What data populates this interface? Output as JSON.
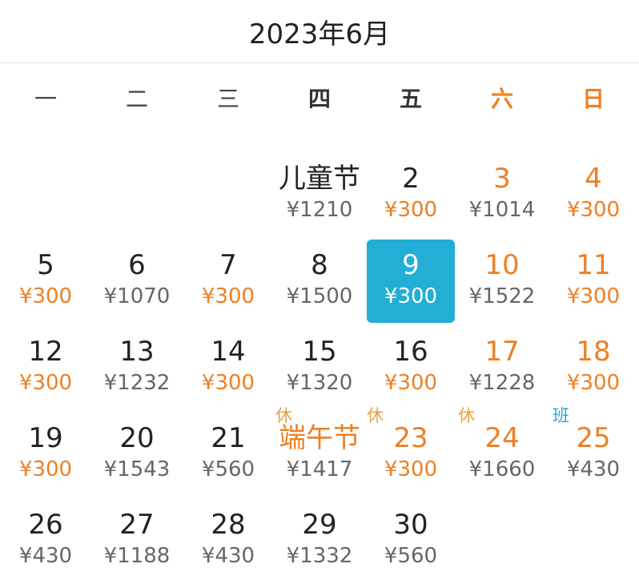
{
  "header": {
    "title": "2023年6月"
  },
  "weekdays": [
    {
      "label": "一",
      "weekend": false,
      "bold": false
    },
    {
      "label": "二",
      "weekend": false,
      "bold": false
    },
    {
      "label": "三",
      "weekend": false,
      "bold": false
    },
    {
      "label": "四",
      "weekend": false,
      "bold": true
    },
    {
      "label": "五",
      "weekend": false,
      "bold": true
    },
    {
      "label": "六",
      "weekend": true,
      "bold": true
    },
    {
      "label": "日",
      "weekend": true,
      "bold": true
    }
  ],
  "colors": {
    "accent": "#ee7f22",
    "selected": "#23aed6",
    "rest_tag": "#e8a245",
    "work_tag": "#2aa5cf"
  },
  "days": [
    {
      "empty": true
    },
    {
      "empty": true
    },
    {
      "empty": true
    },
    {
      "day": "儿童节",
      "price": "¥1210",
      "day_orange": false,
      "price_orange": false,
      "holiday": true
    },
    {
      "day": "2",
      "price": "¥300",
      "day_orange": false,
      "price_orange": true
    },
    {
      "day": "3",
      "price": "¥1014",
      "day_orange": true,
      "price_orange": false
    },
    {
      "day": "4",
      "price": "¥300",
      "day_orange": true,
      "price_orange": true
    },
    {
      "day": "5",
      "price": "¥300",
      "day_orange": false,
      "price_orange": true
    },
    {
      "day": "6",
      "price": "¥1070",
      "day_orange": false,
      "price_orange": false
    },
    {
      "day": "7",
      "price": "¥300",
      "day_orange": false,
      "price_orange": true
    },
    {
      "day": "8",
      "price": "¥1500",
      "day_orange": false,
      "price_orange": false
    },
    {
      "day": "9",
      "price": "¥300",
      "day_orange": false,
      "price_orange": false,
      "selected": true
    },
    {
      "day": "10",
      "price": "¥1522",
      "day_orange": true,
      "price_orange": false
    },
    {
      "day": "11",
      "price": "¥300",
      "day_orange": true,
      "price_orange": true
    },
    {
      "day": "12",
      "price": "¥300",
      "day_orange": false,
      "price_orange": true
    },
    {
      "day": "13",
      "price": "¥1232",
      "day_orange": false,
      "price_orange": false
    },
    {
      "day": "14",
      "price": "¥300",
      "day_orange": false,
      "price_orange": true
    },
    {
      "day": "15",
      "price": "¥1320",
      "day_orange": false,
      "price_orange": false
    },
    {
      "day": "16",
      "price": "¥300",
      "day_orange": false,
      "price_orange": true
    },
    {
      "day": "17",
      "price": "¥1228",
      "day_orange": true,
      "price_orange": false
    },
    {
      "day": "18",
      "price": "¥300",
      "day_orange": true,
      "price_orange": true
    },
    {
      "day": "19",
      "price": "¥300",
      "day_orange": false,
      "price_orange": true
    },
    {
      "day": "20",
      "price": "¥1543",
      "day_orange": false,
      "price_orange": false
    },
    {
      "day": "21",
      "price": "¥560",
      "day_orange": false,
      "price_orange": false
    },
    {
      "day": "端午节",
      "price": "¥1417",
      "day_orange": true,
      "price_orange": false,
      "holiday": true,
      "tag": "休"
    },
    {
      "day": "23",
      "price": "¥300",
      "day_orange": true,
      "price_orange": true,
      "tag": "休"
    },
    {
      "day": "24",
      "price": "¥1660",
      "day_orange": true,
      "price_orange": false,
      "tag": "休"
    },
    {
      "day": "25",
      "price": "¥430",
      "day_orange": true,
      "price_orange": false,
      "tag": "班",
      "tag_work": true
    },
    {
      "day": "26",
      "price": "¥430",
      "day_orange": false,
      "price_orange": false
    },
    {
      "day": "27",
      "price": "¥1188",
      "day_orange": false,
      "price_orange": false
    },
    {
      "day": "28",
      "price": "¥430",
      "day_orange": false,
      "price_orange": false
    },
    {
      "day": "29",
      "price": "¥1332",
      "day_orange": false,
      "price_orange": false
    },
    {
      "day": "30",
      "price": "¥560",
      "day_orange": false,
      "price_orange": false
    }
  ]
}
